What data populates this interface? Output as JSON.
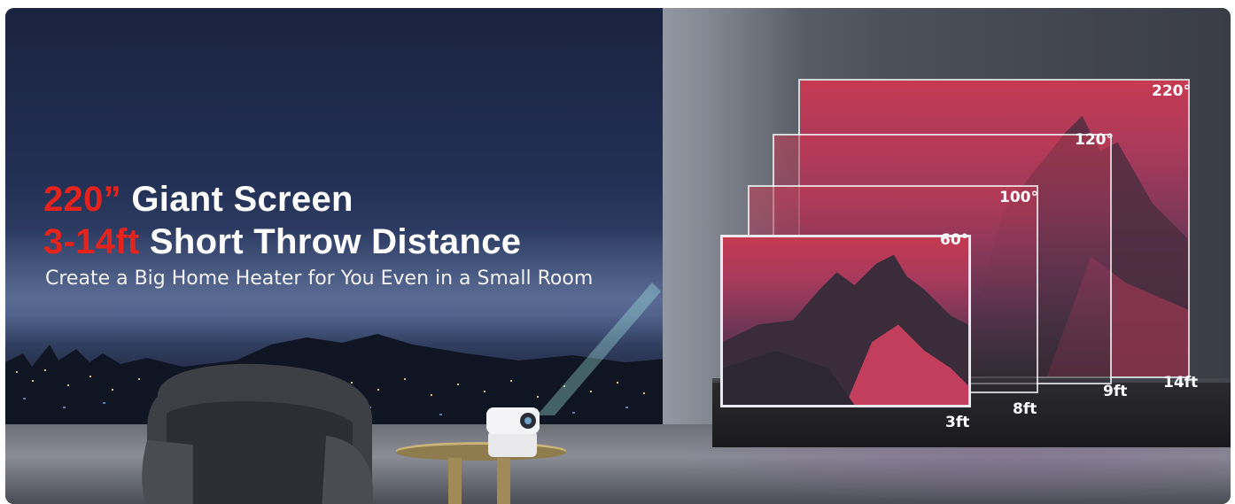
{
  "headline": {
    "line1_accent": "220”",
    "line1_rest": " Giant Screen",
    "line2_accent": "3-14ft",
    "line2_rest": " Short Throw Distance"
  },
  "subtitle": "Create a Big Home Heater for You Even in a Small Room",
  "screen_sizes": [
    "220°",
    "120°",
    "100°",
    "60°"
  ],
  "distances": [
    "3ft",
    "8ft",
    "9ft",
    "14ft"
  ],
  "colors": {
    "accent_red": "#e5231d",
    "text_white": "#ffffff",
    "screen_gradient_top": "#c63a52"
  }
}
